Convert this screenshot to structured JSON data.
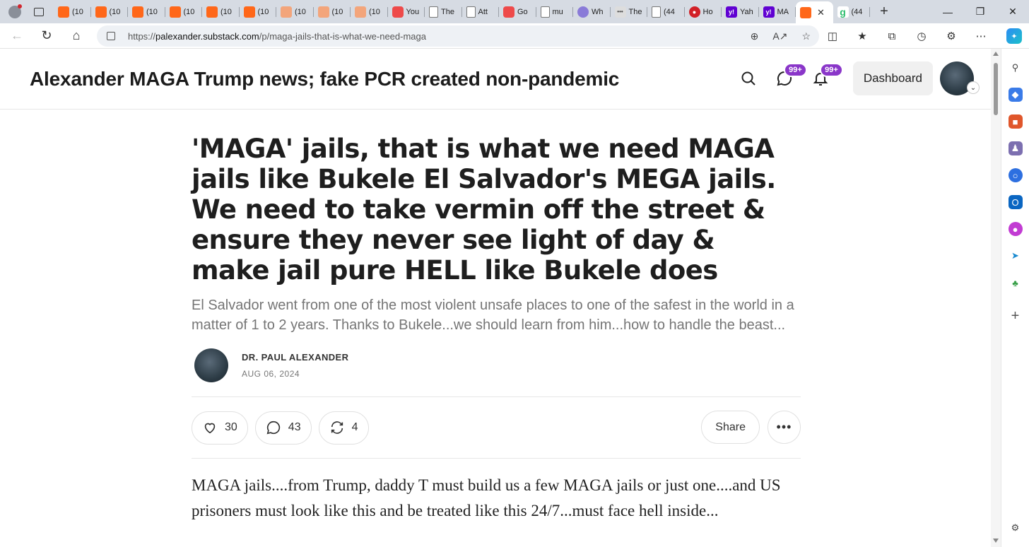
{
  "browser": {
    "tabs": [
      {
        "icon": "substack",
        "label": "(10"
      },
      {
        "icon": "substack",
        "label": "(10"
      },
      {
        "icon": "substack",
        "label": "(10"
      },
      {
        "icon": "substack",
        "label": "(10"
      },
      {
        "icon": "substack",
        "label": "(10"
      },
      {
        "icon": "substack",
        "label": "(10"
      },
      {
        "icon": "substack-dim",
        "label": "(10"
      },
      {
        "icon": "substack-dim",
        "label": "(10"
      },
      {
        "icon": "substack-dim",
        "label": "(10"
      },
      {
        "icon": "youtube",
        "label": "You"
      },
      {
        "icon": "document",
        "label": "The"
      },
      {
        "icon": "document",
        "label": "Att"
      },
      {
        "icon": "youtube",
        "label": "Go"
      },
      {
        "icon": "document",
        "label": "mu"
      },
      {
        "icon": "purple-circle",
        "label": "Wh"
      },
      {
        "icon": "dots",
        "label": "The"
      },
      {
        "icon": "document",
        "label": "(44"
      },
      {
        "icon": "red-circle",
        "label": "Ho"
      },
      {
        "icon": "yahoo",
        "label": "Yah"
      },
      {
        "icon": "yahoo",
        "label": "MA"
      }
    ],
    "active_tab_icon": "substack",
    "extra_tab": {
      "icon": "green-g",
      "label": "(44"
    },
    "url_host": "palexander.substack.com",
    "url_prefix": "https://",
    "url_path": "/p/maga-jails-that-is-what-we-need-maga"
  },
  "site": {
    "title": "Alexander MAGA Trump news; fake PCR created non-pandemic",
    "chat_badge": "99+",
    "notif_badge": "99+",
    "dashboard_label": "Dashboard"
  },
  "post": {
    "title": "'MAGA' jails, that is what we need MAGA jails like Bukele El Salvador's MEGA jails. We need to take vermin off the street & ensure they never see light of day & make jail pure HELL like Bukele does",
    "subtitle": "El Salvador went from one of the most violent unsafe places to one of the safest in the world in a matter of 1 to 2 years. Thanks to Bukele...we should learn from him...how to handle the beast...",
    "author": "DR. PAUL ALEXANDER",
    "date": "AUG 06, 2024",
    "likes": "30",
    "comments": "43",
    "restacks": "4",
    "share_label": "Share",
    "body": "MAGA jails....from Trump, daddy T must build us a few MAGA jails or just one....and US prisoners must look like this and be treated like this 24/7...must face hell inside..."
  }
}
